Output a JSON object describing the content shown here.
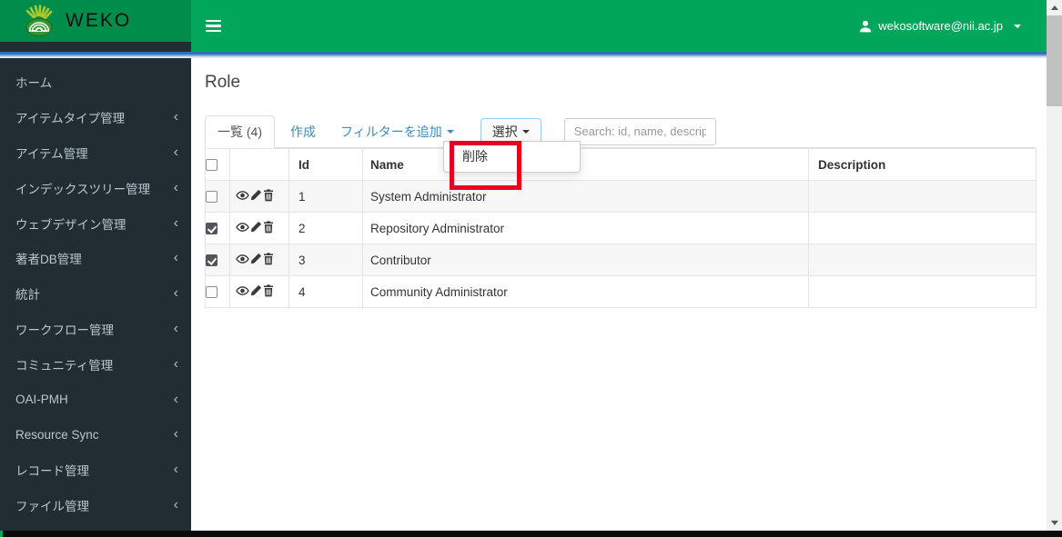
{
  "brand": {
    "name": "WEKO"
  },
  "topbar": {
    "user_email": "wekosoftware@nii.ac.jp"
  },
  "sidebar": {
    "chevron": "‹",
    "items": [
      {
        "label": "ホーム",
        "has_children": false
      },
      {
        "label": "アイテムタイプ管理",
        "has_children": true
      },
      {
        "label": "アイテム管理",
        "has_children": true
      },
      {
        "label": "インデックスツリー管理",
        "has_children": true
      },
      {
        "label": "ウェブデザイン管理",
        "has_children": true
      },
      {
        "label": "著者DB管理",
        "has_children": true
      },
      {
        "label": "統計",
        "has_children": true
      },
      {
        "label": "ワークフロー管理",
        "has_children": true
      },
      {
        "label": "コミュニティ管理",
        "has_children": true
      },
      {
        "label": "OAI-PMH",
        "has_children": true
      },
      {
        "label": "Resource Sync",
        "has_children": true
      },
      {
        "label": "レコード管理",
        "has_children": true
      },
      {
        "label": "ファイル管理",
        "has_children": true
      }
    ]
  },
  "page": {
    "title": "Role"
  },
  "toolbar": {
    "tab_list": "一覧 (4)",
    "tab_create": "作成",
    "filter_label": "フィルターを追加",
    "select_button": "選択",
    "search_placeholder": "Search: id, name, descript",
    "dropdown_delete": "削除"
  },
  "table": {
    "headers": {
      "id": "Id",
      "name": "Name",
      "description": "Description"
    },
    "row_icons": [
      "eye-icon",
      "pencil-icon",
      "trash-icon"
    ],
    "rows": [
      {
        "checked": false,
        "id": "1",
        "name": "System Administrator",
        "description": ""
      },
      {
        "checked": true,
        "id": "2",
        "name": "Repository Administrator",
        "description": ""
      },
      {
        "checked": true,
        "id": "3",
        "name": "Contributor",
        "description": ""
      },
      {
        "checked": false,
        "id": "4",
        "name": "Community Administrator",
        "description": ""
      }
    ]
  },
  "colors": {
    "navbar_green": "#00a65a",
    "logo_green": "#008d4c",
    "sidebar_dark": "#222d32",
    "link_blue": "#3c8dbc",
    "header_link_blue": "#337ab7",
    "annotation_red": "#e8001e"
  }
}
